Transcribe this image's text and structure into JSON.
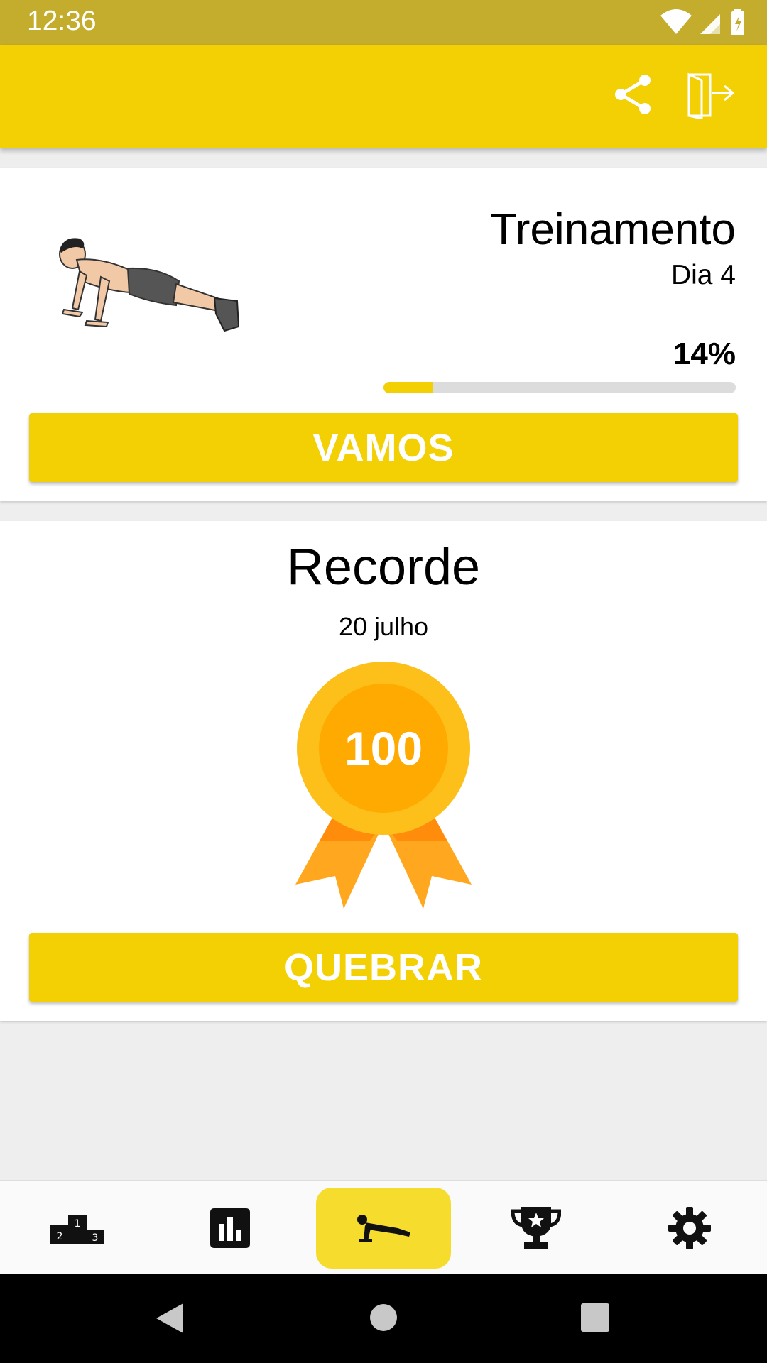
{
  "status_bar": {
    "time": "12:36"
  },
  "app_bar": {
    "icons": [
      "share-icon",
      "exit-door-icon"
    ]
  },
  "training": {
    "title": "Treinamento",
    "day": "Dia 4",
    "percent": "14%",
    "progress": 0.14,
    "button_label": "VAMOS"
  },
  "record": {
    "title": "Recorde",
    "date": "20 julho",
    "value": "100",
    "button_label": "QUEBRAR"
  },
  "bottom_nav": {
    "items": [
      {
        "icon": "podium-icon",
        "active": false
      },
      {
        "icon": "bar-chart-icon",
        "active": false
      },
      {
        "icon": "pushup-icon",
        "active": true
      },
      {
        "icon": "trophy-icon",
        "active": false
      },
      {
        "icon": "gear-icon",
        "active": false
      }
    ]
  },
  "colors": {
    "accent": "#f2d004",
    "status_bar": "#c4ac2d",
    "medal_outer": "#fdbf1a",
    "medal_inner": "#ffaa00",
    "ribbon": "#ff9a1a"
  }
}
